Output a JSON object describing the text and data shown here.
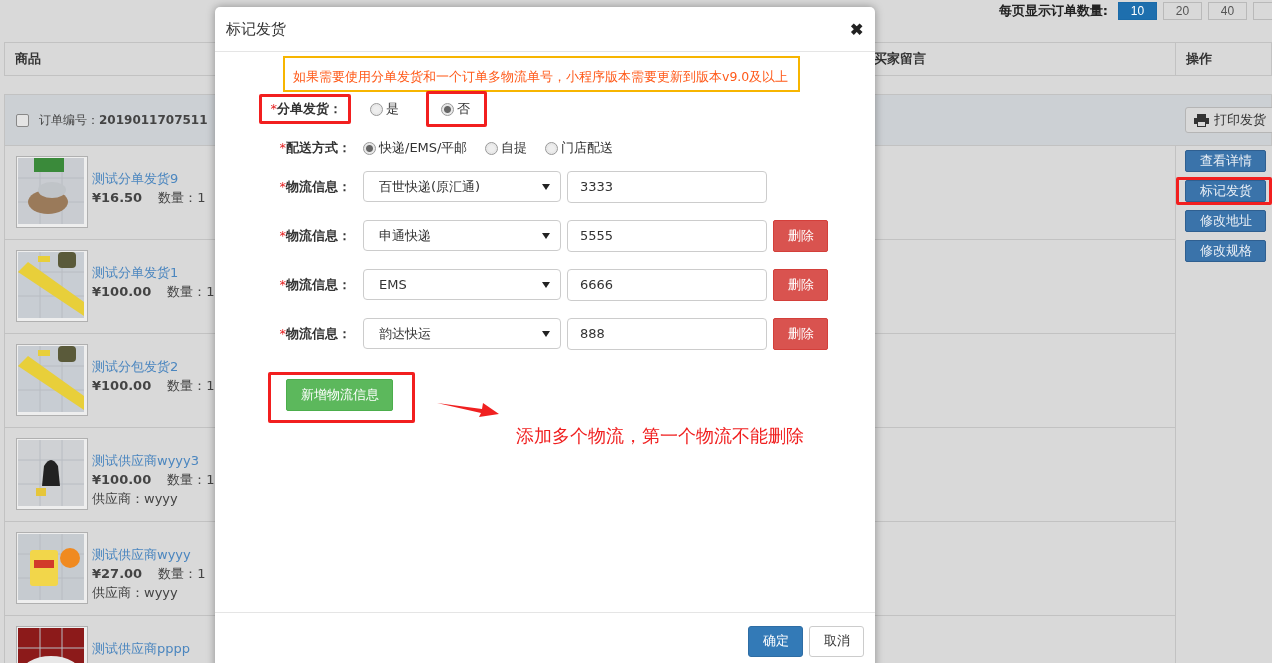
{
  "pager": {
    "label": "每页显示订单数量:",
    "options": [
      {
        "label": "10",
        "selected": true
      },
      {
        "label": "20",
        "selected": false
      },
      {
        "label": "40",
        "selected": false
      }
    ]
  },
  "table": {
    "columns": [
      "商品",
      "买家留言",
      "操作"
    ]
  },
  "order": {
    "checked": false,
    "number_label": "订单编号：",
    "number": "2019011707511",
    "print_button": "打印发货",
    "products": [
      {
        "name": "测试分单发货9",
        "price": "¥16.50",
        "qty": "数量：1"
      },
      {
        "name": "测试分单发货1",
        "price": "¥100.00",
        "qty": "数量：1"
      },
      {
        "name": "测试分包发货2",
        "price": "¥100.00",
        "qty": "数量：1"
      },
      {
        "name": "测试供应商wyyy3",
        "price": "¥100.00",
        "qty": "数量：1",
        "supplier": "供应商：wyyy"
      },
      {
        "name": "测试供应商wyyy",
        "price": "¥27.00",
        "qty": "数量：1",
        "supplier": "供应商：wyyy"
      },
      {
        "name": "测试供应商pppp"
      }
    ],
    "actions": [
      {
        "label": "查看详情",
        "highlighted": false
      },
      {
        "label": "标记发货",
        "highlighted": true
      },
      {
        "label": "修改地址",
        "highlighted": false
      },
      {
        "label": "修改规格",
        "highlighted": false
      }
    ]
  },
  "modal": {
    "title": "标记发货",
    "close": "✖",
    "notice": "如果需要使用分单发货和一个订单多物流单号，小程序版本需要更新到版本v9.0及以上",
    "split": {
      "mark": "*",
      "label": "分单发货：",
      "highlighted": true,
      "options": [
        {
          "label": "是",
          "selected": false,
          "highlighted": false
        },
        {
          "label": "否",
          "selected": true,
          "highlighted": true
        }
      ]
    },
    "delivery": {
      "mark": "*",
      "label": "配送方式：",
      "options": [
        {
          "label": "快递/EMS/平邮",
          "selected": true
        },
        {
          "label": "自提",
          "selected": false
        },
        {
          "label": "门店配送",
          "selected": false
        }
      ]
    },
    "logistics": [
      {
        "mark": "*",
        "label": "物流信息：",
        "carrier": "百世快递(原汇通)",
        "tracking": "3333"
      },
      {
        "mark": "*",
        "label": "物流信息：",
        "carrier": "申通快递",
        "tracking": "5555",
        "delete": "删除"
      },
      {
        "mark": "*",
        "label": "物流信息：",
        "carrier": "EMS",
        "tracking": "6666",
        "delete": "删除"
      },
      {
        "mark": "*",
        "label": "物流信息：",
        "carrier": "韵达快运",
        "tracking": "888",
        "delete": "删除"
      }
    ],
    "add_button": {
      "label": "新增物流信息",
      "highlighted": true
    },
    "annotation": "添加多个物流，第一个物流不能删除",
    "buttons": [
      {
        "label": "确定",
        "kind": "primary"
      },
      {
        "label": "取消",
        "kind": "default"
      }
    ]
  }
}
